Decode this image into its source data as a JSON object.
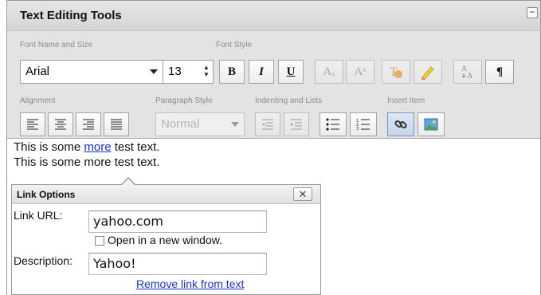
{
  "panel": {
    "title": "Text Editing Tools",
    "collapse_label": "−"
  },
  "toolbar": {
    "groups": {
      "font_name_size": "Font Name and Size",
      "font_style": "Font Style",
      "alignment": "Alignment",
      "paragraph_style": "Paragraph Style",
      "indenting": "Indenting and Lists",
      "insert_item": "Insert Item"
    },
    "font_name": "Arial",
    "font_size": "13",
    "paragraph_style_value": "Normal",
    "bold_label": "B",
    "italic_label": "I",
    "underline_label": "U",
    "subscript_label": "Aₓ",
    "superscript_label": "Aˣ",
    "pilcrow_label": "¶"
  },
  "content": {
    "line1_prefix": "This is some ",
    "line1_link": "more",
    "line1_suffix": " test text.",
    "line2": "This is some more test text."
  },
  "link_options": {
    "title": "Link Options",
    "close_label": "✕",
    "url_label": "Link URL:",
    "url_value": "yahoo.com",
    "new_window_label": "Open in a new window.",
    "description_label": "Description:",
    "description_value": "Yahoo!",
    "remove_link": "Remove link from text"
  }
}
